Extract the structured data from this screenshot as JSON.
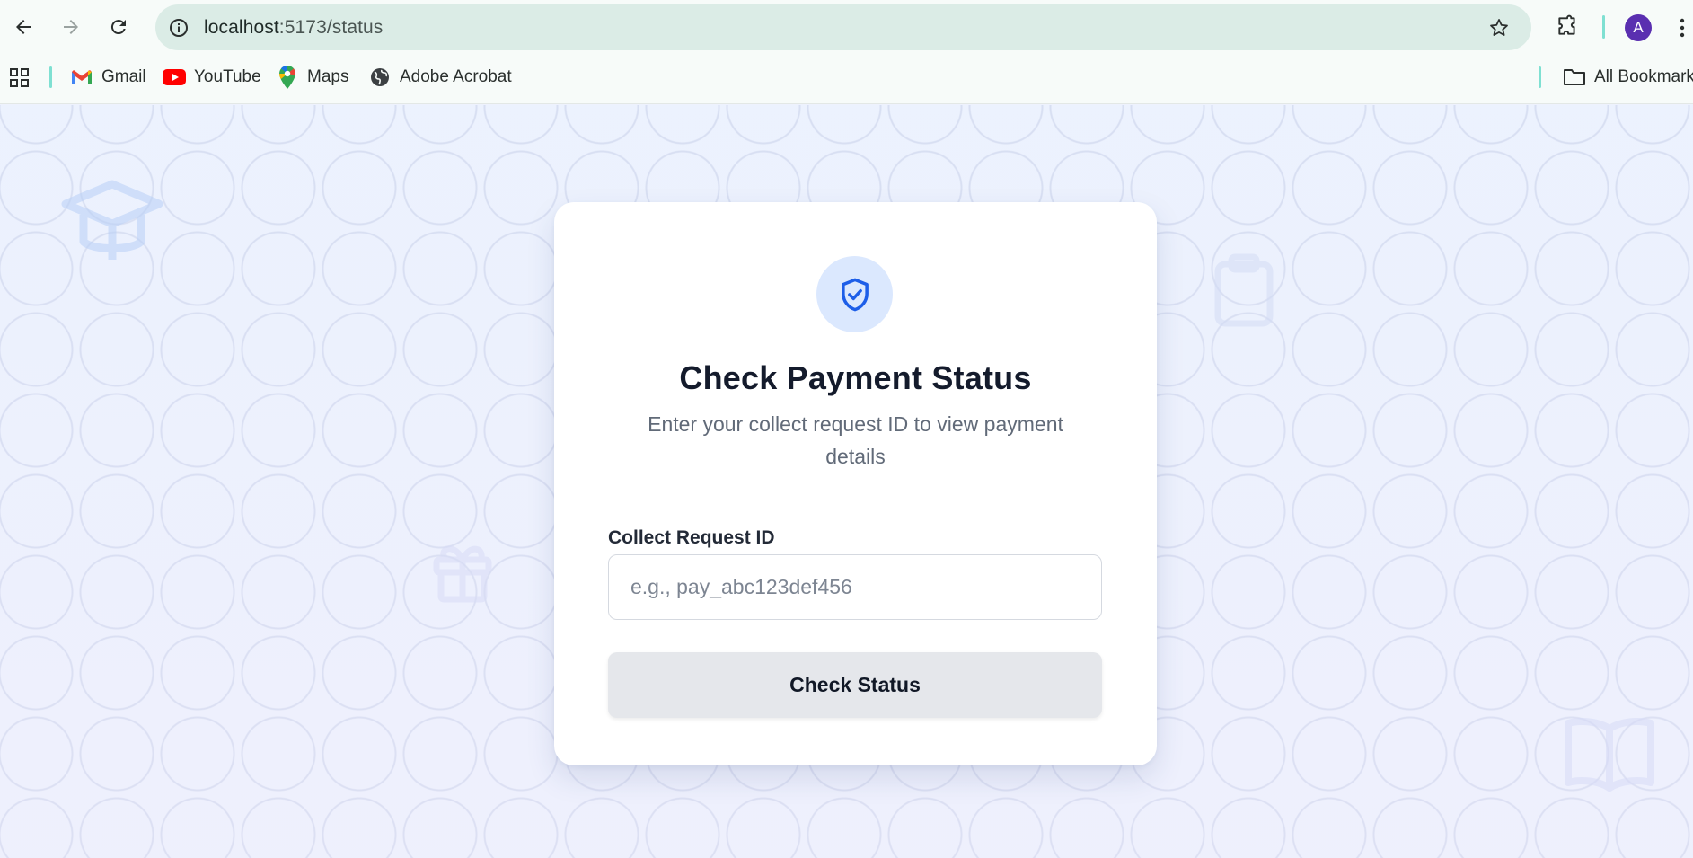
{
  "browser": {
    "url_host": "localhost",
    "url_path": ":5173/status",
    "profile_initial": "A",
    "bookmarks": [
      {
        "label": "Gmail",
        "icon": "gmail-icon"
      },
      {
        "label": "YouTube",
        "icon": "youtube-icon"
      },
      {
        "label": "Maps",
        "icon": "maps-icon"
      },
      {
        "label": "Adobe Acrobat",
        "icon": "globe-icon"
      }
    ],
    "all_bookmarks_label": "All Bookmarks"
  },
  "card": {
    "icon": "shield-check-icon",
    "title": "Check Payment Status",
    "subtitle": "Enter your collect request ID to view payment details",
    "field_label": "Collect Request ID",
    "input_placeholder": "e.g., pay_abc123def456",
    "input_value": "",
    "button_label": "Check Status"
  },
  "colors": {
    "accent": "#1d5ee8",
    "icon_bg": "#dbe8fe",
    "button_bg": "#e5e7eb",
    "page_bg": "#edf2fd"
  }
}
